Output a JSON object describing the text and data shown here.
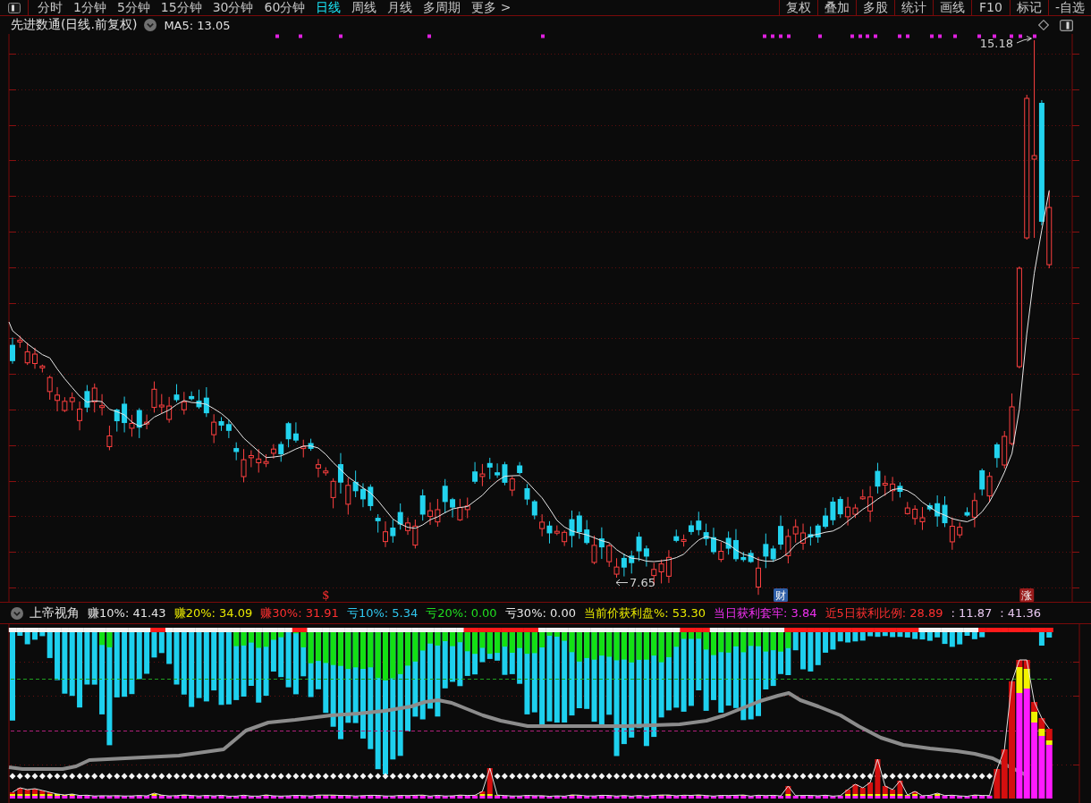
{
  "toolbar": {
    "period_tabs": [
      {
        "label": "分时",
        "selected": false
      },
      {
        "label": "1分钟",
        "selected": false
      },
      {
        "label": "5分钟",
        "selected": false
      },
      {
        "label": "15分钟",
        "selected": false
      },
      {
        "label": "30分钟",
        "selected": false
      },
      {
        "label": "60分钟",
        "selected": false
      },
      {
        "label": "日线",
        "selected": true
      },
      {
        "label": "周线",
        "selected": false
      },
      {
        "label": "月线",
        "selected": false
      },
      {
        "label": "多周期",
        "selected": false
      },
      {
        "label": "更多 >",
        "selected": false
      }
    ],
    "tool_buttons": [
      "复权",
      "叠加",
      "多股",
      "统计",
      "画线",
      "F10",
      "标记",
      "-自选"
    ]
  },
  "main_chart": {
    "title": "先进数通(日线.前复权)",
    "ma_label": "MA5: 13.05",
    "high_label": "15.18",
    "low_label": "7.65",
    "markers": [
      {
        "kind": "glyph",
        "text": "$",
        "color": "#ff3030"
      },
      {
        "kind": "badge",
        "text": "财",
        "color": "#2f5fa8"
      },
      {
        "kind": "badge",
        "text": "涨",
        "color": "#9a1c1c"
      }
    ]
  },
  "indicator": {
    "title": "上帝视角",
    "values": [
      {
        "text": "赚10%: 41.43",
        "color": "#e6e6e6"
      },
      {
        "text": "赚20%: 34.09",
        "color": "#e8e800"
      },
      {
        "text": "赚30%: 31.91",
        "color": "#ff3030"
      },
      {
        "text": "亏10%: 5.34",
        "color": "#30c8f0"
      },
      {
        "text": "亏20%: 0.00",
        "color": "#20dd20"
      },
      {
        "text": "亏30%: 0.00",
        "color": "#e6e6e6"
      },
      {
        "text": "当前价获利盘%: 53.30",
        "color": "#e8e800"
      },
      {
        "text": "当日获利套牢: 3.84",
        "color": "#f030f0"
      },
      {
        "text": "近5日获利比例: 28.89",
        "color": "#ff3030"
      },
      {
        "text": ": 11.87",
        "color": "#e8c8f0"
      },
      {
        "text": ": 41.36",
        "color": "#e8c8f0"
      }
    ]
  }
}
